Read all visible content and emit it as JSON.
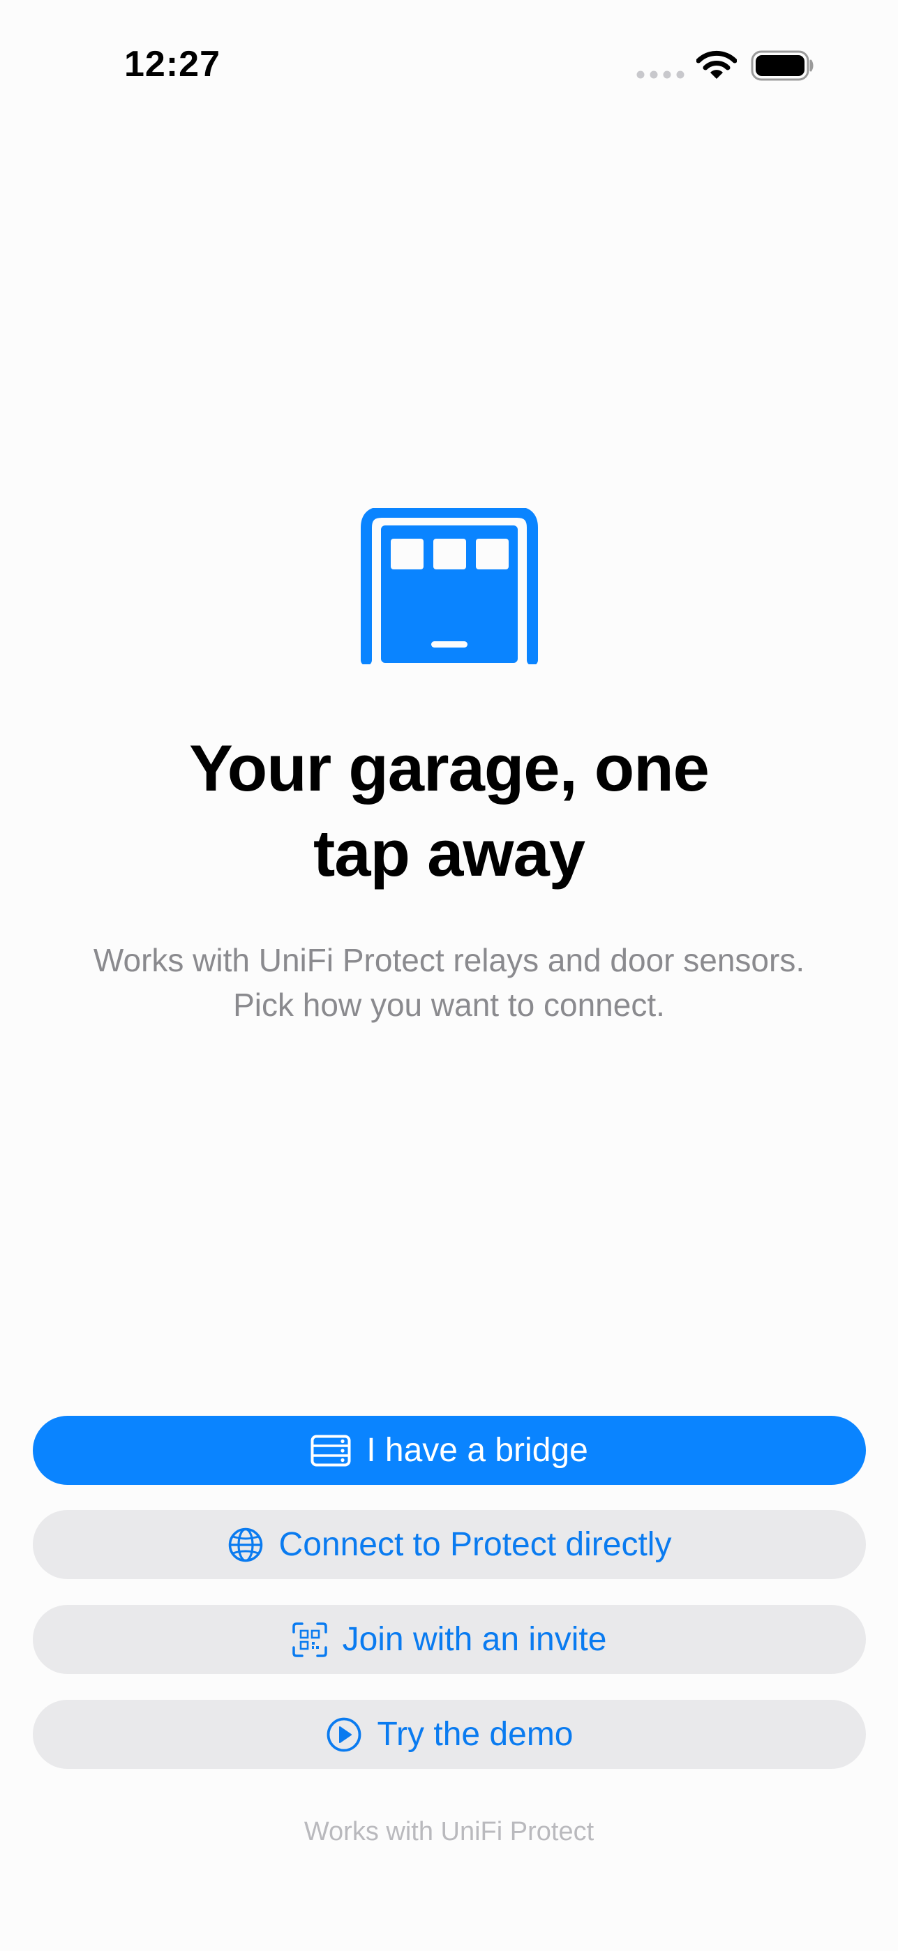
{
  "status_bar": {
    "time": "12:27"
  },
  "hero": {
    "icon": "garage-door-icon",
    "title_line1": "Your garage, one",
    "title_line2": "tap away",
    "subtitle_line1": "Works with UniFi Protect relays and door sensors.",
    "subtitle_line2": "Pick how you want to connect."
  },
  "actions": {
    "bridge": {
      "label": "I have a bridge",
      "icon": "server-icon"
    },
    "protect": {
      "label": "Connect to Protect directly",
      "icon": "globe-icon"
    },
    "invite": {
      "label": "Join with an invite",
      "icon": "qr-code-icon"
    },
    "demo": {
      "label": "Try the demo",
      "icon": "play-circle-icon"
    }
  },
  "footer": {
    "note": "Works with UniFi Protect"
  },
  "colors": {
    "accent": "#0a84ff",
    "secondary_button_bg": "#e9e9eb",
    "subtitle_text": "#8a8a8e",
    "footer_text": "#b9b9bd"
  }
}
